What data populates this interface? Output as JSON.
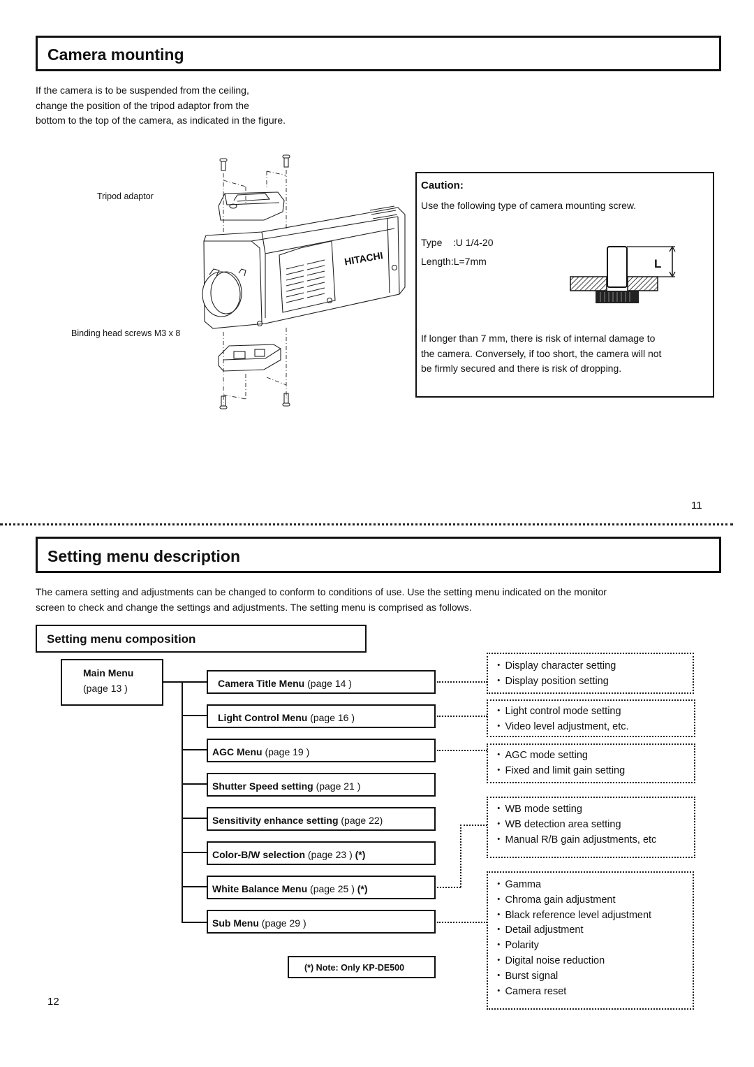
{
  "top_page": {
    "title": "Camera mounting",
    "intro_lines": [
      "If the camera is to be suspended from the ceiling,",
      "change the position of the tripod adaptor from the",
      "bottom to the top of the camera, as indicated in the figure."
    ],
    "figure": {
      "label_tripod": "Tripod adaptor",
      "label_screws": "Binding head screws M3 x 8",
      "brand_text": "HITACHI"
    },
    "caution": {
      "title": "Caution:",
      "line1": "Use the following type of camera mounting screw.",
      "type_label": "Type    :U 1/4-20",
      "length_label": "Length:L=7mm",
      "dimension_label": "L",
      "warning_lines": [
        "If longer than 7 mm, there is risk of internal damage to",
        "the camera. Conversely, if too short, the camera will not",
        "be firmly secured and there is risk of dropping."
      ]
    },
    "page_number": "11"
  },
  "bottom_page": {
    "title": "Setting menu description",
    "intro_lines": [
      "The camera setting and adjustments can be changed to conform to conditions of use. Use the setting menu indicated on the monitor",
      "screen to check and change the settings and adjustments. The setting menu is comprised as follows."
    ],
    "subsection_title": "Setting menu composition",
    "main_menu": {
      "name": "Main Menu",
      "page": "(page 13 )"
    },
    "menus": [
      {
        "name": "Camera Title Menu",
        "page": " (page 14 )",
        "mark": ""
      },
      {
        "name": "Light Control Menu",
        "page": " (page 16 )",
        "mark": ""
      },
      {
        "name": "AGC Menu",
        "page": " (page 19 )",
        "mark": ""
      },
      {
        "name": "Shutter Speed setting",
        "page": " (page 21 )",
        "mark": ""
      },
      {
        "name": "Sensitivity enhance setting",
        "page": " (page 22)",
        "mark": ""
      },
      {
        "name": "Color-B/W selection",
        "page": " (page 23 ) ",
        "mark": "(*)"
      },
      {
        "name": "White Balance Menu",
        "page": " (page 25 ) ",
        "mark": "(*)"
      },
      {
        "name": "Sub Menu",
        "page": " (page 29 )",
        "mark": ""
      }
    ],
    "descriptions": [
      {
        "for": "Camera Title Menu",
        "items": [
          "Display character setting",
          "Display position setting"
        ]
      },
      {
        "for": "Light Control Menu",
        "items": [
          "Light control mode setting",
          "Video level adjustment, etc."
        ]
      },
      {
        "for": "AGC Menu",
        "items": [
          "AGC mode setting",
          "Fixed and limit gain setting"
        ]
      },
      {
        "for": "White Balance Menu",
        "items": [
          "WB mode setting",
          "WB detection area setting",
          "Manual R/B gain adjustments, etc"
        ]
      },
      {
        "for": "Sub Menu",
        "items": [
          "Gamma",
          "Chroma gain adjustment",
          "Black reference level adjustment",
          "Detail adjustment",
          "Polarity",
          "Digital noise reduction",
          "Burst signal",
          "Camera reset"
        ]
      }
    ],
    "note": "(*) Note: Only KP-DE500",
    "page_number": "12"
  }
}
